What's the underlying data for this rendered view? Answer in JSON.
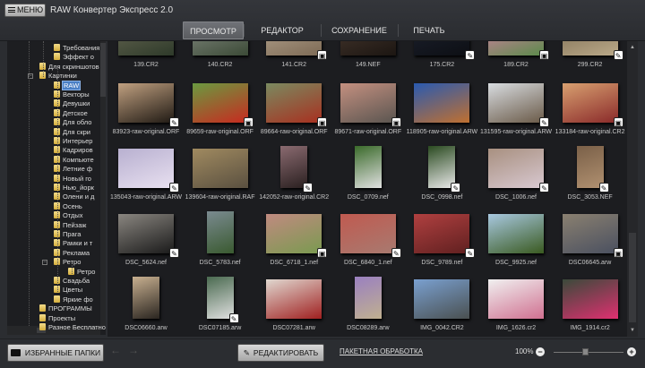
{
  "app": {
    "menu_label": "МЕНЮ",
    "title": "RAW Конвертер Экспресс 2.0"
  },
  "tabs": [
    {
      "label": "ПРОСМОТР",
      "active": true
    },
    {
      "label": "РЕДАКТОР"
    },
    {
      "label": "СОХРАНЕНИЕ"
    },
    {
      "label": "ПЕЧАТЬ"
    }
  ],
  "tree": [
    {
      "label": "Требования",
      "level": 2
    },
    {
      "label": "Эффект о",
      "level": 2
    },
    {
      "label": "Для скриншотов",
      "level": 1
    },
    {
      "label": "Картинки",
      "level": 1,
      "expanded": true
    },
    {
      "label": "RAW",
      "level": 2,
      "selected": true
    },
    {
      "label": "Векторы",
      "level": 2
    },
    {
      "label": "Девушки",
      "level": 2
    },
    {
      "label": "Детское",
      "level": 2
    },
    {
      "label": "Для обло",
      "level": 2
    },
    {
      "label": "Для скри",
      "level": 2
    },
    {
      "label": "Интерьер",
      "level": 2
    },
    {
      "label": "Кадриров",
      "level": 2
    },
    {
      "label": "Компьюте",
      "level": 2
    },
    {
      "label": "Летние ф",
      "level": 2
    },
    {
      "label": "Новый го",
      "level": 2
    },
    {
      "label": "Нью_йорк",
      "level": 2
    },
    {
      "label": "Олени и д",
      "level": 2
    },
    {
      "label": "Осень",
      "level": 2
    },
    {
      "label": "Отдых",
      "level": 2
    },
    {
      "label": "Пейзаж",
      "level": 2
    },
    {
      "label": "Прага",
      "level": 2
    },
    {
      "label": "Рамки и т",
      "level": 2
    },
    {
      "label": "Реклама",
      "level": 2
    },
    {
      "label": "Ретро",
      "level": 2,
      "expanded": true
    },
    {
      "label": "Ретро",
      "level": 3
    },
    {
      "label": "Свадьба",
      "level": 2
    },
    {
      "label": "Цветы",
      "level": 2
    },
    {
      "label": "Яркие фо",
      "level": 2
    },
    {
      "label": "ПРОГРАММЫ",
      "level": 1
    },
    {
      "label": "Проекты",
      "level": 1
    },
    {
      "label": "Разное Бесплатно",
      "level": 1
    }
  ],
  "photos": [
    [
      {
        "name": "139.CR2",
        "badge": "",
        "c": [
          "#6b6a55",
          "#2e3a2a"
        ]
      },
      {
        "name": "140.CR2",
        "badge": "",
        "c": [
          "#8a8f88",
          "#3b4a36"
        ]
      },
      {
        "name": "141.CR2",
        "badge": "save",
        "c": [
          "#b9a994",
          "#7d6a55"
        ]
      },
      {
        "name": "149.NEF",
        "badge": "",
        "c": [
          "#4a3a30",
          "#1c1612"
        ]
      },
      {
        "name": "175.CR2",
        "badge": "edit",
        "c": [
          "#1d2230",
          "#0d0f14"
        ]
      },
      {
        "name": "189.CR2",
        "badge": "save",
        "c": [
          "#e27fae",
          "#5a8a4a"
        ]
      },
      {
        "name": "299.CR2",
        "badge": "edit",
        "c": [
          "#7a6a50",
          "#b9a888"
        ]
      }
    ],
    [
      {
        "name": "83923-raw-original.ORF",
        "badge": "edit",
        "c": [
          "#c0a080",
          "#201a14"
        ]
      },
      {
        "name": "89659-raw-original.ORF",
        "badge": "save",
        "c": [
          "#6a9a40",
          "#c82a20"
        ]
      },
      {
        "name": "89664-raw-original.ORF",
        "badge": "save",
        "c": [
          "#7a8a60",
          "#a83020"
        ]
      },
      {
        "name": "89671-raw-original.ORF",
        "badge": "save",
        "c": [
          "#c49080",
          "#5a5550"
        ]
      },
      {
        "name": "118905-raw-original.ARW",
        "badge": "",
        "c": [
          "#2a5ab0",
          "#c07030"
        ]
      },
      {
        "name": "131595-raw-original.ARW",
        "badge": "edit",
        "c": [
          "#d8dce0",
          "#6a5a48"
        ]
      },
      {
        "name": "133184-raw-original.CR2",
        "badge": "save",
        "c": [
          "#d8a070",
          "#8a2a2a"
        ]
      }
    ],
    [
      {
        "name": "135043-raw-original.ARW",
        "badge": "edit",
        "c": [
          "#b8b0d0",
          "#e8e0f0"
        ]
      },
      {
        "name": "139604-raw-original.RAF",
        "badge": "",
        "c": [
          "#a08a60",
          "#5a5040"
        ]
      },
      {
        "name": "142052-raw-original.CR2",
        "badge": "edit",
        "p": 1,
        "c": [
          "#8a6a70",
          "#2a2020"
        ]
      },
      {
        "name": "DSC_0709.nef",
        "badge": "",
        "p": 1,
        "c": [
          "#3a6a2a",
          "#e0e0e0"
        ]
      },
      {
        "name": "DSC_0998.nef",
        "badge": "edit",
        "p": 1,
        "c": [
          "#2a4a20",
          "#e8e8e8"
        ]
      },
      {
        "name": "DSC_1006.nef",
        "badge": "edit",
        "c": [
          "#a89080",
          "#d8c8d0"
        ]
      },
      {
        "name": "DSC_3053.NEF",
        "badge": "edit",
        "p": 1,
        "c": [
          "#7a6048",
          "#b09070"
        ]
      }
    ],
    [
      {
        "name": "DSC_5624.nef",
        "badge": "edit",
        "c": [
          "#8a8680",
          "#1a1a1a"
        ]
      },
      {
        "name": "DSC_5783.nef",
        "badge": "",
        "p": 1,
        "c": [
          "#7a8a90",
          "#3a5a30"
        ]
      },
      {
        "name": "DSC_6718_1.nef",
        "badge": "save",
        "c": [
          "#c08a80",
          "#7a9a50"
        ]
      },
      {
        "name": "DSC_6840_1.nef",
        "badge": "edit",
        "c": [
          "#c05a50",
          "#a87a70"
        ]
      },
      {
        "name": "DSC_9789.nef",
        "badge": "edit",
        "c": [
          "#b04040",
          "#602020"
        ]
      },
      {
        "name": "DSC_9925.nef",
        "badge": "",
        "c": [
          "#a8c8e0",
          "#3a5a20"
        ]
      },
      {
        "name": "DSC06645.arw",
        "badge": "save",
        "c": [
          "#8a8070",
          "#4a5060"
        ]
      }
    ],
    [
      {
        "name": "DSC06660.arw",
        "badge": "",
        "p": 1,
        "c": [
          "#c8b090",
          "#2a2520"
        ]
      },
      {
        "name": "DSC07185.arw",
        "badge": "edit",
        "p": 1,
        "c": [
          "#4a6a50",
          "#e0e0e0"
        ]
      },
      {
        "name": "DSC07281.arw",
        "badge": "",
        "c": [
          "#e0d8d0",
          "#a02020"
        ]
      },
      {
        "name": "DSC08289.arw",
        "badge": "",
        "p": 1,
        "c": [
          "#9a80c0",
          "#c0b090"
        ]
      },
      {
        "name": "IMG_0042.CR2",
        "badge": "",
        "c": [
          "#7aa0d0",
          "#4a5050"
        ]
      },
      {
        "name": "IMG_1626.cr2",
        "badge": "",
        "c": [
          "#f0f0f0",
          "#d07090"
        ]
      },
      {
        "name": "IMG_1914.cr2",
        "badge": "",
        "c": [
          "#3a4a3a",
          "#e03070"
        ]
      }
    ]
  ],
  "bottom": {
    "favorites_label": "ИЗБРАННЫЕ ПАПКИ",
    "edit_label": "РЕДАКТИРОВАТЬ",
    "batch_label": "ПАКЕТНАЯ ОБРАБОТКА",
    "zoom": "100%",
    "zoom_fraction": 0.45
  }
}
